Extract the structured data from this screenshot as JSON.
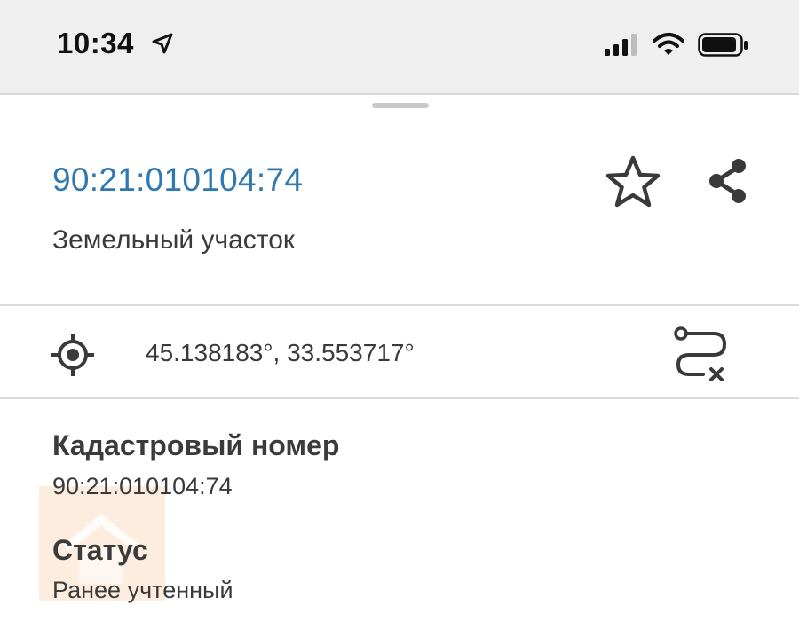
{
  "status_bar": {
    "time": "10:34",
    "icons": [
      "location-arrow-icon",
      "cellular-signal-icon",
      "wifi-icon",
      "battery-icon"
    ]
  },
  "card": {
    "title": "90:21:010104:74",
    "subtitle": "Земельный участок",
    "actions": [
      "star-icon",
      "share-icon"
    ]
  },
  "location": {
    "coordinates": "45.138183°, 33.553717°",
    "icons": [
      "target-icon",
      "route-clear-icon"
    ]
  },
  "details": [
    {
      "label": "Кадастровый номер",
      "value": "90:21:010104:74"
    },
    {
      "label": "Статус",
      "value": "Ранее учтенный"
    }
  ],
  "colors": {
    "accent": "#2f78b1",
    "status_bar_bg": "#efefef",
    "text": "#3a3a3a"
  }
}
